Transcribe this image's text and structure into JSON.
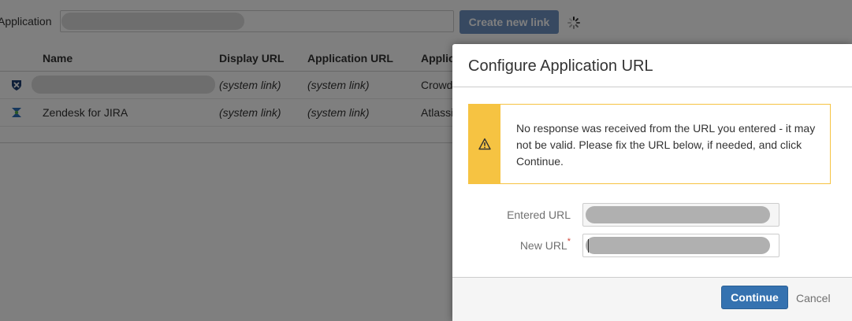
{
  "background": {
    "application_label": "Application",
    "create_button_label": "Create new link",
    "table": {
      "columns": [
        "Name",
        "Display URL",
        "Application URL",
        "Applic"
      ],
      "rows": [
        {
          "name": "",
          "display_url": "(system link)",
          "application_url": "(system link)",
          "type": "Crowd",
          "icon": "crowd-icon"
        },
        {
          "name": "Zendesk for JIRA",
          "display_url": "(system link)",
          "application_url": "(system link)",
          "type": "Atlassi",
          "icon": "zendesk-icon"
        }
      ]
    }
  },
  "dialog": {
    "title": "Configure Application URL",
    "warning": {
      "icon": "warning-icon",
      "message": "No response was received from the URL you entered - it may not be valid. Please fix the URL below, if needed, and click Continue."
    },
    "fields": {
      "entered_url_label": "Entered URL",
      "new_url_label": "New URL",
      "required_marker": "*"
    },
    "footer": {
      "continue_label": "Continue",
      "cancel_label": "Cancel"
    }
  },
  "colors": {
    "primary": "#3572b0",
    "warning": "#f6c342",
    "required": "#d04437"
  }
}
